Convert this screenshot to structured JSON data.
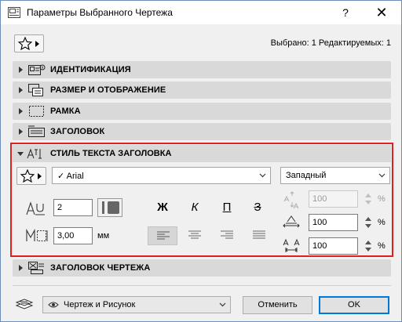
{
  "window": {
    "title": "Параметры Выбранного Чертежа",
    "help_label": "?",
    "close_label": "✕"
  },
  "status": {
    "text": "Выбрано: 1 Редактируемых: 1"
  },
  "panels": [
    {
      "label": "ИДЕНТИФИКАЦИЯ",
      "icon": "id-icon",
      "expanded": false
    },
    {
      "label": "РАЗМЕР И ОТОБРАЖЕНИЕ",
      "icon": "size-display-icon",
      "expanded": false
    },
    {
      "label": "РАМКА",
      "icon": "frame-icon",
      "expanded": false
    },
    {
      "label": "ЗАГОЛОВОК",
      "icon": "title-icon",
      "expanded": false
    },
    {
      "label": "СТИЛЬ ТЕКСТА ЗАГОЛОВКА",
      "icon": "text-style-icon",
      "expanded": true
    },
    {
      "label": "ЗАГОЛОВОК ЧЕРТЕЖА",
      "icon": "drawing-title-icon",
      "expanded": false
    }
  ],
  "text_style": {
    "font": {
      "check": "✓",
      "value": "Arial"
    },
    "script": {
      "value": "Западный"
    },
    "size": {
      "value": "2"
    },
    "width": {
      "value": "3,00",
      "unit": "мм"
    },
    "format_buttons": {
      "bold": "Ж",
      "italic": "К",
      "underline": "П",
      "strikethrough": "З"
    },
    "alignment": {
      "active": "left",
      "options": [
        "left",
        "center",
        "right",
        "justify"
      ]
    },
    "pen_color": "#666666",
    "spacing_percent": {
      "value": "100",
      "unit": "%",
      "disabled": true
    },
    "width_factor_percent": {
      "value": "100",
      "unit": "%"
    },
    "char_spacing_percent": {
      "value": "100",
      "unit": "%"
    }
  },
  "footer": {
    "layer_value": "Чертеж и Рисунок",
    "cancel_label": "Отменить",
    "ok_label": "OK"
  },
  "colors": {
    "highlight_border": "#e02020",
    "default_button_border": "#0078d7",
    "panel_bg": "#d9d9d9"
  }
}
